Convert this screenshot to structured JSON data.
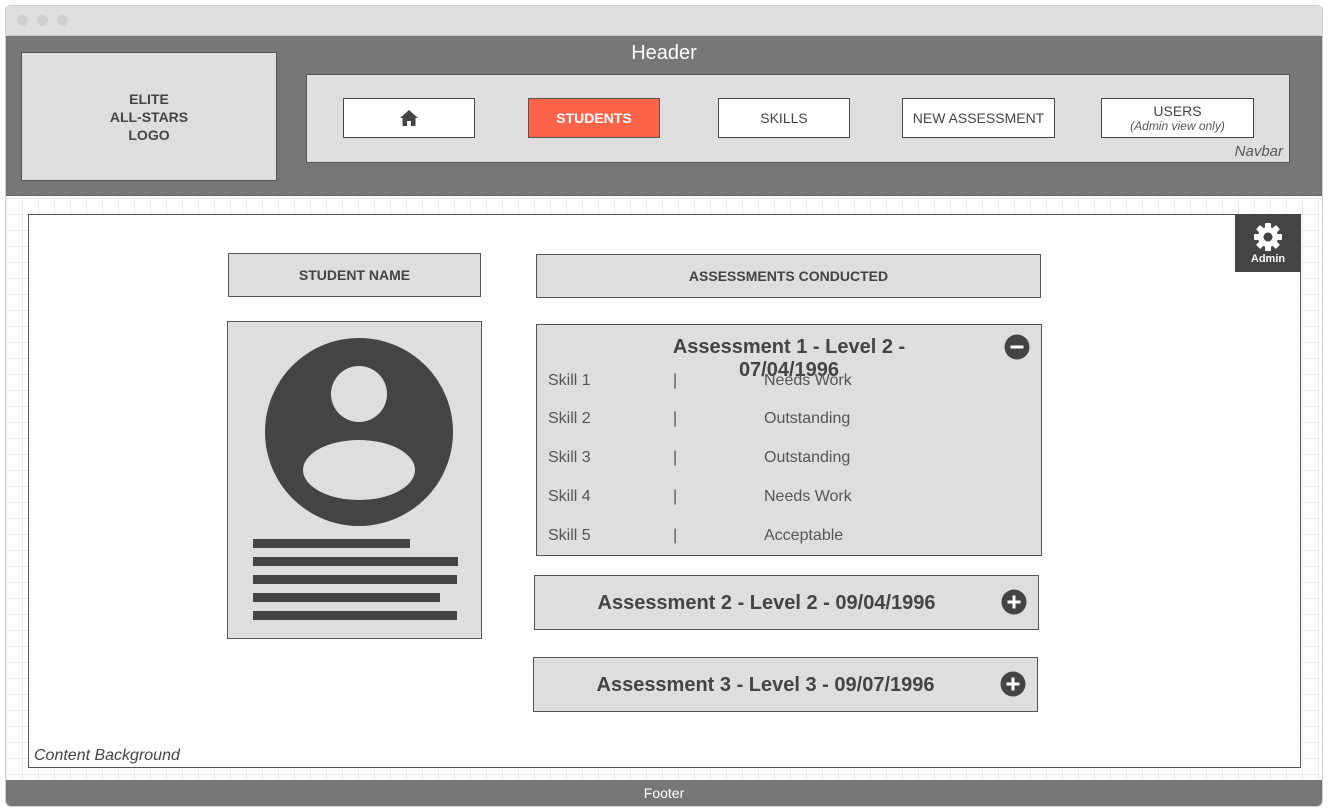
{
  "header": {
    "title": "Header",
    "logo_lines": [
      "ELITE",
      "ALL-STARS",
      "LOGO"
    ]
  },
  "navbar": {
    "label": "Navbar",
    "items": [
      {
        "icon": "home-icon",
        "label": ""
      },
      {
        "label": "STUDENTS",
        "active": true
      },
      {
        "label": "SKILLS"
      },
      {
        "label": "NEW ASSESSMENT"
      },
      {
        "label": "USERS",
        "sublabel": "(Admin view only)"
      }
    ],
    "active_color": "#ff634a"
  },
  "admin": {
    "icon": "gear-icon",
    "label": "Admin"
  },
  "student": {
    "title": "STUDENT NAME",
    "avatar_icon": "user-avatar-icon"
  },
  "assessments": {
    "title": "ASSESSMENTS CONDUCTED",
    "list": [
      {
        "title": "Assessment 1 - Level 2 - 07/04/1996",
        "expanded": true,
        "toggle_icon": "minus-circle-icon",
        "skills": [
          {
            "skill": "Skill 1",
            "sep": "|",
            "rating": "Needs Work"
          },
          {
            "skill": "Skill 2",
            "sep": "|",
            "rating": "Outstanding"
          },
          {
            "skill": "Skill 3",
            "sep": "|",
            "rating": "Outstanding"
          },
          {
            "skill": "Skill 4",
            "sep": "|",
            "rating": "Needs Work"
          },
          {
            "skill": "Skill 5",
            "sep": "|",
            "rating": "Acceptable"
          }
        ]
      },
      {
        "title": "Assessment 2 - Level 2 - 09/04/1996",
        "expanded": false,
        "toggle_icon": "plus-circle-icon"
      },
      {
        "title": "Assessment 3 - Level 3 - 09/07/1996",
        "expanded": false,
        "toggle_icon": "plus-circle-icon"
      }
    ]
  },
  "content": {
    "label": "Content Background"
  },
  "footer": {
    "label": "Footer"
  }
}
